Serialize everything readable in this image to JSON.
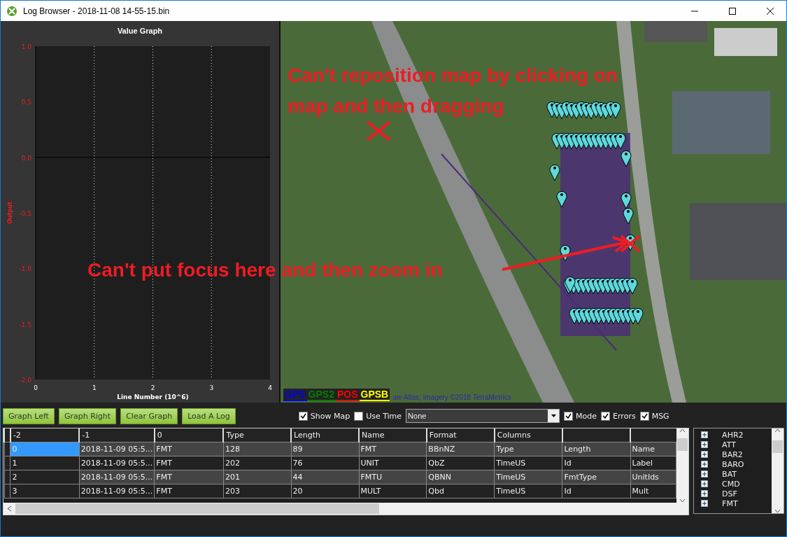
{
  "window": {
    "title": "Log Browser - 2018-11-08 14-55-15.bin"
  },
  "graph": {
    "title": "Value Graph",
    "chart_data": {
      "type": "line",
      "grid": true,
      "xlabel": "Line Number (10^6)",
      "ylabel": "Output",
      "xlim": [
        0,
        4
      ],
      "ylim": [
        -2,
        1
      ],
      "xticks": [
        0,
        1,
        2,
        3,
        4
      ],
      "yticks": [
        {
          "value": -2,
          "label": "-2.0"
        },
        {
          "value": -1.5,
          "label": "-1.5"
        },
        {
          "value": -1,
          "label": "-1.0"
        },
        {
          "value": -0.5,
          "label": "-0.5"
        },
        {
          "value": 0,
          "label": "0.0"
        },
        {
          "value": 0.5,
          "label": "0.5"
        },
        {
          "value": 1,
          "label": "1.0"
        }
      ]
    }
  },
  "map": {
    "legend": [
      {
        "label": "GPS",
        "color": "#0000ff"
      },
      {
        "label": "GPS2",
        "color": "#008000"
      },
      {
        "label": "POS",
        "color": "#ff0000"
      },
      {
        "label": "GPSB",
        "color": "#ffff00"
      }
    ],
    "attribution": "ale Atlas, Imagery ©2018 TerraMetrics"
  },
  "annotations": [
    {
      "kind": "note",
      "text": "Can't reposition map by clicking on map and then dragging"
    },
    {
      "kind": "note",
      "text": "Can't put focus here and then zoom in"
    }
  ],
  "buttons": [
    "Graph Left",
    "Graph Right",
    "Clear Graph",
    "Load A Log"
  ],
  "options": [
    {
      "label": "Show Map",
      "checked": true
    },
    {
      "label": "Use Time",
      "checked": false
    }
  ],
  "dropdown": {
    "value": "None"
  },
  "filters": [
    {
      "label": "Mode",
      "checked": true
    },
    {
      "label": "Errors",
      "checked": true
    },
    {
      "label": "MSG",
      "checked": true
    }
  ],
  "table": {
    "columns": [
      "-2",
      "-1",
      "0",
      "Type",
      "Length",
      "Name",
      "Format",
      "Columns"
    ],
    "rows": [
      {
        "selected": true,
        "cells": [
          "0",
          "2018-11-09 05:5...",
          "FMT",
          "128",
          "89",
          "FMT",
          "BBnNZ",
          "Type",
          "Length",
          "Name"
        ]
      },
      {
        "selected": false,
        "cells": [
          "1",
          "2018-11-09 05:5...",
          "FMT",
          "202",
          "76",
          "UNIT",
          "QbZ",
          "TimeUS",
          "Id",
          "Label"
        ]
      },
      {
        "selected": false,
        "cells": [
          "2",
          "2018-11-09 05:5...",
          "FMT",
          "201",
          "44",
          "FMTU",
          "QBNN",
          "TimeUS",
          "FmtType",
          "UnitIds"
        ]
      },
      {
        "selected": false,
        "cells": [
          "3",
          "2018-11-09 05:5...",
          "FMT",
          "203",
          "20",
          "MULT",
          "Qbd",
          "TimeUS",
          "Id",
          "Mult"
        ]
      }
    ]
  },
  "message_types": [
    {
      "label": "AHR2",
      "expanded": false
    },
    {
      "label": "ATT",
      "expanded": false
    },
    {
      "label": "BAR2",
      "expanded": false
    },
    {
      "label": "BARO",
      "expanded": false
    },
    {
      "label": "BAT",
      "expanded": false
    },
    {
      "label": "CMD",
      "expanded": false
    },
    {
      "label": "DSF",
      "expanded": false
    },
    {
      "label": "FMT",
      "expanded": false
    }
  ]
}
